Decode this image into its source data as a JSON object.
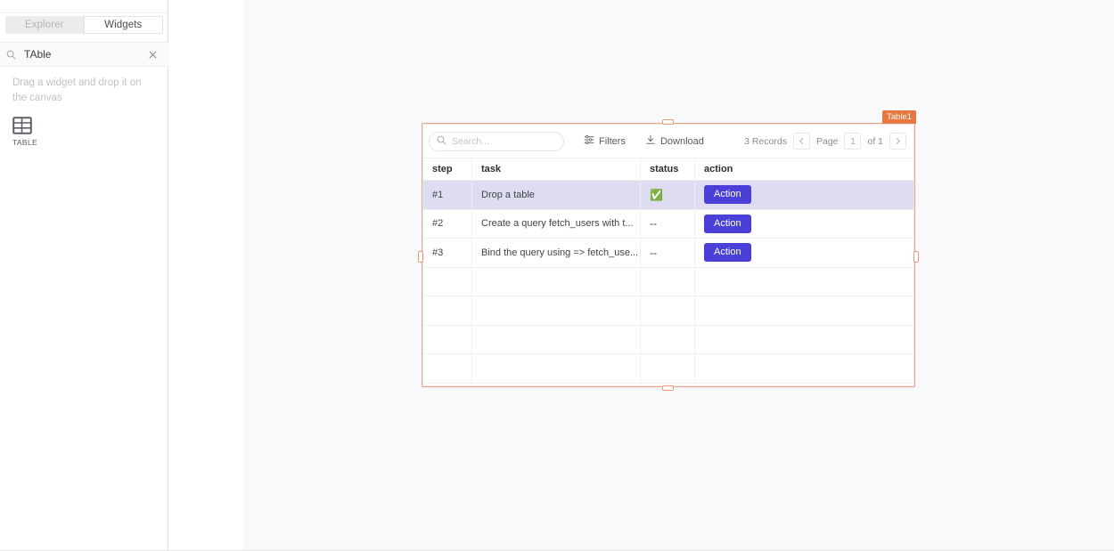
{
  "sidebar": {
    "tabs": [
      {
        "label": "Explorer",
        "active": false
      },
      {
        "label": "Widgets",
        "active": true
      }
    ],
    "search": {
      "value": "TAble",
      "icon": "search-icon",
      "clear_icon": "close-icon"
    },
    "hint": "Drag a widget and drop it on the canvas",
    "widgets": [
      {
        "label": "TABLE",
        "icon": "table-icon"
      }
    ]
  },
  "widget": {
    "badge_label": "Table1",
    "accent_color": "#e8763f",
    "outline_color": "#f0a58a"
  },
  "table": {
    "toolbar": {
      "search_placeholder": "Search...",
      "search_value": "",
      "filters_label": "Filters",
      "download_label": "Download"
    },
    "pagination": {
      "records_label": "3 Records",
      "prev_icon": "chevron-left-icon",
      "next_icon": "chevron-right-icon",
      "page_label": "Page",
      "page_value": "1",
      "of_label": "of 1"
    },
    "columns": [
      {
        "key": "step",
        "label": "step"
      },
      {
        "key": "task",
        "label": "task"
      },
      {
        "key": "status",
        "label": "status"
      },
      {
        "key": "action",
        "label": "action"
      }
    ],
    "rows": [
      {
        "step": "#1",
        "task": "Drop a table",
        "status": "✅",
        "action_label": "Action",
        "selected": true
      },
      {
        "step": "#2",
        "task": "Create a query fetch_users with t...",
        "status": "--",
        "action_label": "Action",
        "selected": false
      },
      {
        "step": "#3",
        "task": "Bind the query using => fetch_use...",
        "status": "--",
        "action_label": "Action",
        "selected": false
      }
    ],
    "empty_row_count": 4,
    "selected_row_color": "#dedcf0",
    "action_button_color": "#4a3fd6"
  }
}
